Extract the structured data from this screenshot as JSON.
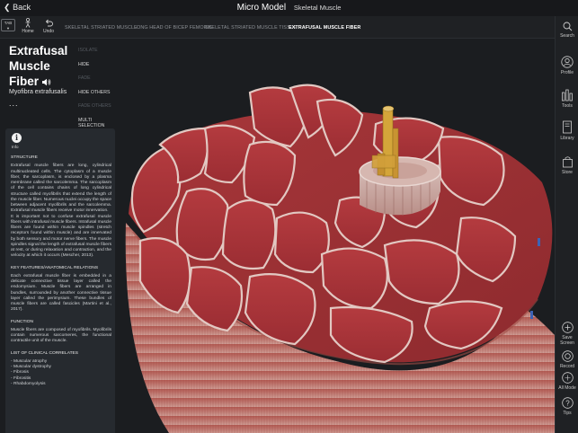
{
  "topbar": {
    "back_label": "Back",
    "title": "Micro Model",
    "subtitle": "Skeletal Muscle"
  },
  "toolbar": {
    "tab_label": "TAB",
    "home_label": "Home",
    "undo_label": "Undo",
    "breadcrumbs": [
      "SKELETAL STRIATED MUSCLE",
      "LONG HEAD OF BICEP FEMORIS",
      "SKELETAL STRIATED MUSCLE TISSUE",
      "EXTRAFUSAL MUSCLE FIBER"
    ]
  },
  "structure": {
    "title_lines": [
      "Extrafusal",
      "Muscle",
      "Fiber"
    ],
    "latin_name": "Myofibra extrafusalis",
    "more": "..."
  },
  "actions": {
    "items": [
      {
        "label": "ISOLATE",
        "enabled": false
      },
      {
        "label": "HIDE",
        "enabled": true
      },
      {
        "label": "FADE",
        "enabled": false
      },
      {
        "label": "HIDE OTHERS",
        "enabled": true
      },
      {
        "label": "FADE OTHERS",
        "enabled": false
      },
      {
        "label": "MULTI SELECTION",
        "enabled": true
      }
    ]
  },
  "info": {
    "label": "Info",
    "structure_heading": "STRUCTURE",
    "structure_p1": "Extrafusal muscle fibers are long, cylindrical multinucleated cells. The cytoplasm of a muscle fiber, the sarcoplasm, is enclosed by a plasma membrane called the sarcolemma. The sarcoplasm of the cell contains chains of long cylindrical structure called myofibrils that extend the length of the muscle fiber. Numerous nuclei occupy the space between adjacent myofibrils and the sarcolemma. Extrafusal muscle fibers receive motor innervation.",
    "structure_p2": "It is important not to confuse extrafusal muscle fibers with intrafusal muscle fibers. Intrafusal muscle fibers are found within muscle spindles (stretch receptors found within muscle) and are innervated by both sensory and motor nerve fibers. The muscle spindles signal the length of extrafusal muscle fibers at rest, or during relaxation and contraction, and the velocity at which it occurs (Mescher, 2013).",
    "relations_heading": "KEY FEATURES/ANATOMICAL RELATIONS",
    "relations_p": "Each extrafusal muscle fiber is embedded in a delicate connective tissue layer called the endomysium. Muscle fibers are arranged in bundles, surrounded by another connective tissue layer called the perimysium. These bundles of muscle fibers are called fascicles (Martini et al., 2017).",
    "function_heading": "FUNCTION",
    "function_p": "Muscle fibers are composed of myofibrils. Myofibrils contain numerous sarcomeres, the functional contractile unit of the muscle.",
    "clinical_heading": "LIST OF CLINICAL CORRELATES",
    "clinical_items": [
      "- Muscular atrophy",
      "- Muscular dystrophy",
      "- Fibrosis",
      "- Fibrositis",
      "- Rhabdomyolysis"
    ]
  },
  "rail": {
    "search": "Search",
    "profile": "Profile",
    "tools": "Tools",
    "library": "Library",
    "store": "Store",
    "save_screen": "Save Screen",
    "record": "Record",
    "all_mode": "All Mode",
    "tips": "Tips"
  }
}
